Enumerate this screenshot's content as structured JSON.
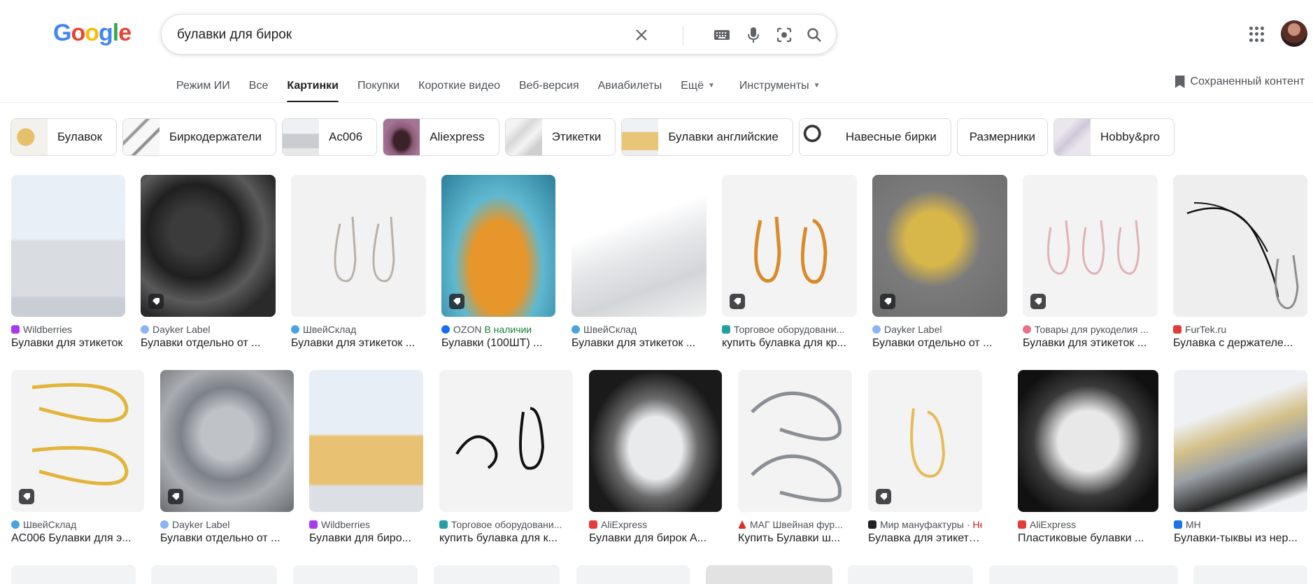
{
  "header": {
    "logo": "Google",
    "search_value": "булавки для бирок"
  },
  "tabs": [
    {
      "label": "Режим ИИ"
    },
    {
      "label": "Все"
    },
    {
      "label": "Картинки",
      "active": true
    },
    {
      "label": "Покупки"
    },
    {
      "label": "Короткие видео"
    },
    {
      "label": "Веб-версия"
    },
    {
      "label": "Авиабилеты"
    },
    {
      "label": "Ещё"
    },
    {
      "label": "Инструменты"
    }
  ],
  "saved_label": "Сохраненный контент",
  "chips": [
    {
      "label": "Булавок"
    },
    {
      "label": "Биркодержатели"
    },
    {
      "label": "Ac006"
    },
    {
      "label": "Aliexpress"
    },
    {
      "label": "Этикетки"
    },
    {
      "label": "Булавки английские"
    },
    {
      "label": "Навесные бирки"
    },
    {
      "label": "Размерники"
    },
    {
      "label": "Hobby&pro"
    }
  ],
  "results_row1": [
    {
      "source": "Wildberries",
      "title": "Булавки для этикеток",
      "tag": false
    },
    {
      "source": "Dayker Label",
      "title": "Булавки отдельно от ...",
      "tag": true
    },
    {
      "source": "ШвейСклад",
      "title": "Булавки для этикеток ...",
      "tag": false
    },
    {
      "source": "OZON",
      "stock": "В наличии",
      "title": "Булавки (100ШТ) ...",
      "tag": true
    },
    {
      "source": "ШвейСклад",
      "title": "Булавки для этикеток ...",
      "tag": false
    },
    {
      "source": "Торговое оборудовани...",
      "title": "купить булавка для кр...",
      "tag": true
    },
    {
      "source": "Dayker Label",
      "title": "Булавки отдельно от ...",
      "tag": true
    },
    {
      "source": "Товары для рукоделия ...",
      "title": "Булавки для этикеток ...",
      "tag": true
    },
    {
      "source": "FurTek.ru",
      "title": "Булавка с держателе...",
      "tag": false
    }
  ],
  "results_row2": [
    {
      "source": "ШвейСклад",
      "title": "AC006 Булавки для э...",
      "tag": true
    },
    {
      "source": "Dayker Label",
      "title": "Булавки отдельно от ...",
      "tag": true
    },
    {
      "source": "Wildberries",
      "title": "Булавки для биро...",
      "tag": false
    },
    {
      "source": "Торговое оборудовани...",
      "title": "купить булавка для к...",
      "tag": false
    },
    {
      "source": "AliExpress",
      "title": "Булавки для бирок A...",
      "tag": false
    },
    {
      "source": "МАГ Швейная фур...",
      "title": "Купить Булавки ш...",
      "tag": false
    },
    {
      "source": "Мир мануфактуры",
      "stock": "· Не...",
      "title": "Булавка для этикеток...",
      "tag": true
    },
    {
      "source": "AliExpress",
      "title": "Пластиковые булавки ...",
      "tag": false
    },
    {
      "source": "МН",
      "title": "Булавки-тыквы из нер...",
      "tag": false
    }
  ],
  "icons": [
    "clear-icon",
    "keyboard-icon",
    "microphone-icon",
    "lens-icon",
    "search-icon",
    "apps-icon",
    "bookmark-icon",
    "tag-icon"
  ]
}
